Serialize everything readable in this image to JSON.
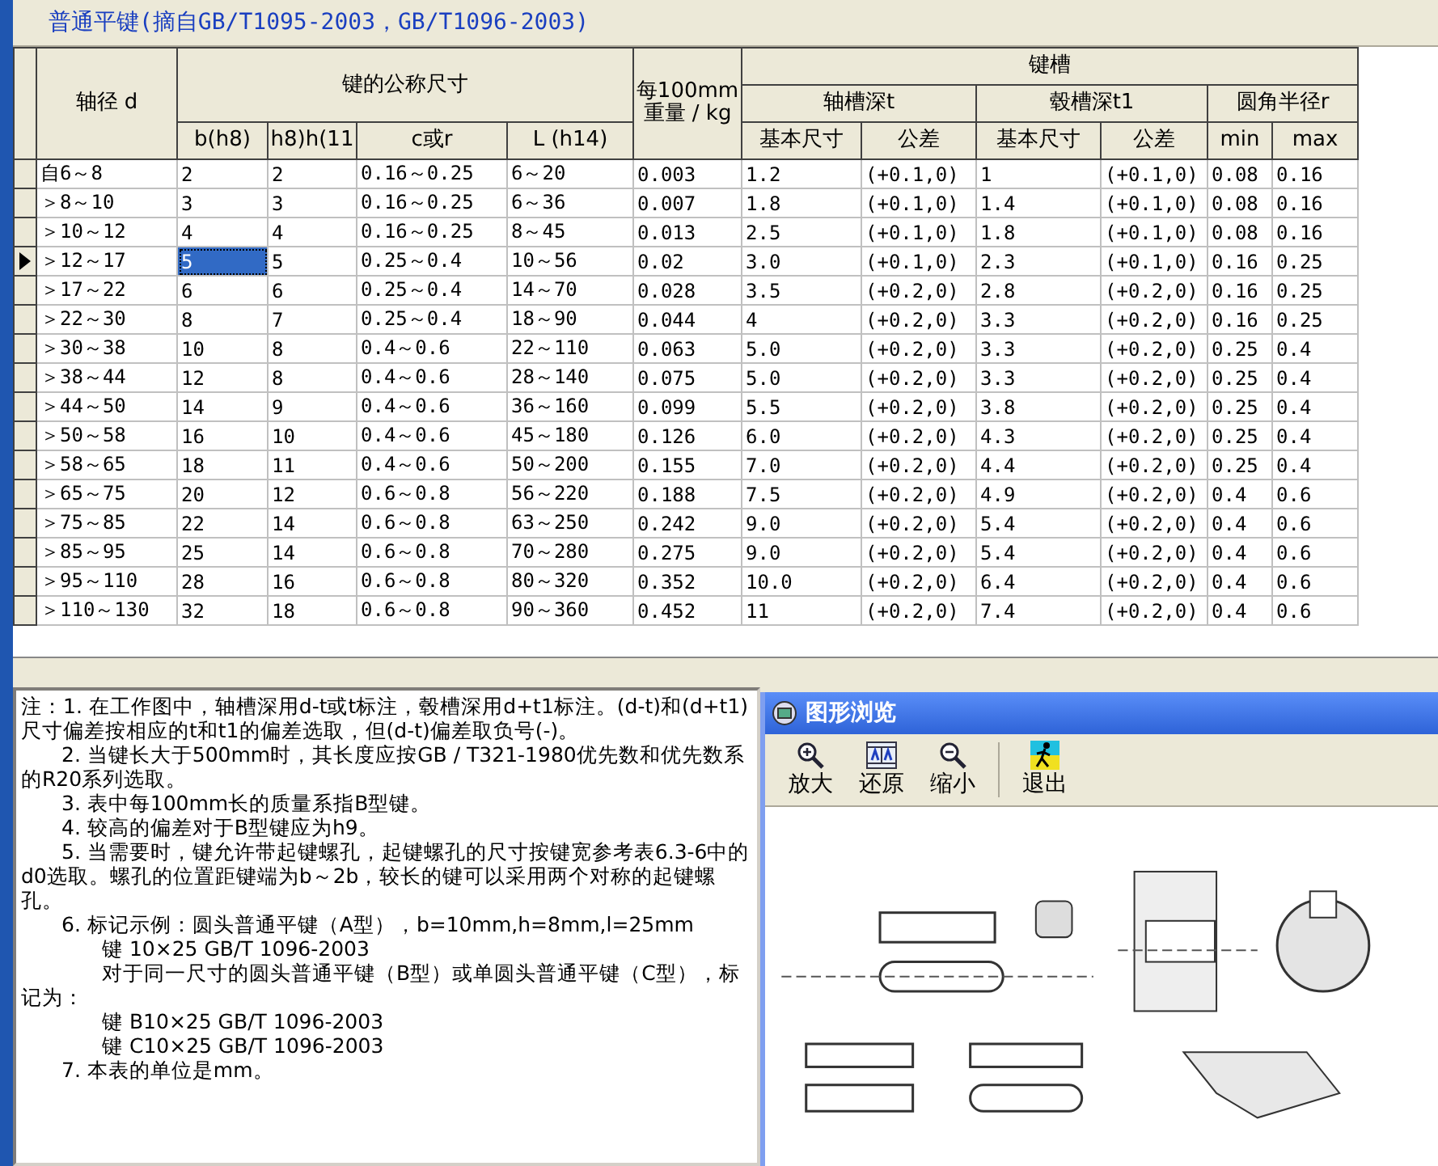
{
  "title": "普通平键(摘自GB/T1095-2003，GB/T1096-2003)",
  "table": {
    "header": [
      {
        "label": "轴径 d"
      },
      {
        "label": "键的公称尺寸",
        "children": [
          {
            "label": "b(h8)"
          },
          {
            "label": "h8)h(11"
          },
          {
            "label": "c或r"
          },
          {
            "label": "L (h14)"
          }
        ]
      },
      {
        "label": "每100mm重量 / kg"
      },
      {
        "label": "键槽",
        "children": [
          {
            "label": "轴槽深t",
            "children": [
              {
                "label": "基本尺寸"
              },
              {
                "label": "公差"
              }
            ]
          },
          {
            "label": "毂槽深t1",
            "children": [
              {
                "label": "基本尺寸"
              },
              {
                "label": "公差"
              }
            ]
          },
          {
            "label": "圆角半径r",
            "children": [
              {
                "label": "min"
              },
              {
                "label": "max"
              }
            ]
          }
        ]
      }
    ],
    "rows": [
      {
        "selected": false,
        "cells": [
          {
            "text": "自6～8",
            "selected": false
          },
          {
            "text": "2",
            "selected": false
          },
          {
            "text": "2",
            "selected": false
          },
          {
            "text": "0.16～0.25",
            "selected": false
          },
          {
            "text": "6～20",
            "selected": false
          },
          {
            "text": "0.003",
            "selected": false
          },
          {
            "text": "1.2",
            "selected": false
          },
          {
            "text": "(+0.1,0)",
            "selected": false
          },
          {
            "text": "1",
            "selected": false
          },
          {
            "text": "(+0.1,0)",
            "selected": false
          },
          {
            "text": "0.08",
            "selected": false
          },
          {
            "text": "0.16",
            "selected": false
          }
        ]
      },
      {
        "selected": false,
        "cells": [
          {
            "text": "＞8～10",
            "selected": false
          },
          {
            "text": "3",
            "selected": false
          },
          {
            "text": "3",
            "selected": false
          },
          {
            "text": "0.16～0.25",
            "selected": false
          },
          {
            "text": "6～36",
            "selected": false
          },
          {
            "text": "0.007",
            "selected": false
          },
          {
            "text": "1.8",
            "selected": false
          },
          {
            "text": "(+0.1,0)",
            "selected": false
          },
          {
            "text": "1.4",
            "selected": false
          },
          {
            "text": "(+0.1,0)",
            "selected": false
          },
          {
            "text": "0.08",
            "selected": false
          },
          {
            "text": "0.16",
            "selected": false
          }
        ]
      },
      {
        "selected": false,
        "cells": [
          {
            "text": "＞10～12",
            "selected": false
          },
          {
            "text": "4",
            "selected": false
          },
          {
            "text": "4",
            "selected": false
          },
          {
            "text": "0.16～0.25",
            "selected": false
          },
          {
            "text": "8～45",
            "selected": false
          },
          {
            "text": "0.013",
            "selected": false
          },
          {
            "text": "2.5",
            "selected": false
          },
          {
            "text": "(+0.1,0)",
            "selected": false
          },
          {
            "text": "1.8",
            "selected": false
          },
          {
            "text": "(+0.1,0)",
            "selected": false
          },
          {
            "text": "0.08",
            "selected": false
          },
          {
            "text": "0.16",
            "selected": false
          }
        ]
      },
      {
        "selected": true,
        "cells": [
          {
            "text": "＞12～17",
            "selected": false
          },
          {
            "text": "5",
            "selected": true
          },
          {
            "text": "5",
            "selected": false
          },
          {
            "text": "0.25～0.4",
            "selected": false
          },
          {
            "text": "10～56",
            "selected": false
          },
          {
            "text": "0.02",
            "selected": false
          },
          {
            "text": "3.0",
            "selected": false
          },
          {
            "text": "(+0.1,0)",
            "selected": false
          },
          {
            "text": "2.3",
            "selected": false
          },
          {
            "text": "(+0.1,0)",
            "selected": false
          },
          {
            "text": "0.16",
            "selected": false
          },
          {
            "text": "0.25",
            "selected": false
          }
        ]
      },
      {
        "selected": false,
        "cells": [
          {
            "text": "＞17～22",
            "selected": false
          },
          {
            "text": "6",
            "selected": false
          },
          {
            "text": "6",
            "selected": false
          },
          {
            "text": "0.25～0.4",
            "selected": false
          },
          {
            "text": "14～70",
            "selected": false
          },
          {
            "text": "0.028",
            "selected": false
          },
          {
            "text": "3.5",
            "selected": false
          },
          {
            "text": "(+0.2,0)",
            "selected": false
          },
          {
            "text": "2.8",
            "selected": false
          },
          {
            "text": "(+0.2,0)",
            "selected": false
          },
          {
            "text": "0.16",
            "selected": false
          },
          {
            "text": "0.25",
            "selected": false
          }
        ]
      },
      {
        "selected": false,
        "cells": [
          {
            "text": "＞22～30",
            "selected": false
          },
          {
            "text": "8",
            "selected": false
          },
          {
            "text": "7",
            "selected": false
          },
          {
            "text": "0.25～0.4",
            "selected": false
          },
          {
            "text": "18～90",
            "selected": false
          },
          {
            "text": "0.044",
            "selected": false
          },
          {
            "text": "4",
            "selected": false
          },
          {
            "text": "(+0.2,0)",
            "selected": false
          },
          {
            "text": "3.3",
            "selected": false
          },
          {
            "text": "(+0.2,0)",
            "selected": false
          },
          {
            "text": "0.16",
            "selected": false
          },
          {
            "text": "0.25",
            "selected": false
          }
        ]
      },
      {
        "selected": false,
        "cells": [
          {
            "text": "＞30～38",
            "selected": false
          },
          {
            "text": "10",
            "selected": false
          },
          {
            "text": "8",
            "selected": false
          },
          {
            "text": "0.4～0.6",
            "selected": false
          },
          {
            "text": "22～110",
            "selected": false
          },
          {
            "text": "0.063",
            "selected": false
          },
          {
            "text": "5.0",
            "selected": false
          },
          {
            "text": "(+0.2,0)",
            "selected": false
          },
          {
            "text": "3.3",
            "selected": false
          },
          {
            "text": "(+0.2,0)",
            "selected": false
          },
          {
            "text": "0.25",
            "selected": false
          },
          {
            "text": "0.4",
            "selected": false
          }
        ]
      },
      {
        "selected": false,
        "cells": [
          {
            "text": "＞38～44",
            "selected": false
          },
          {
            "text": "12",
            "selected": false
          },
          {
            "text": "8",
            "selected": false
          },
          {
            "text": "0.4～0.6",
            "selected": false
          },
          {
            "text": "28～140",
            "selected": false
          },
          {
            "text": "0.075",
            "selected": false
          },
          {
            "text": "5.0",
            "selected": false
          },
          {
            "text": "(+0.2,0)",
            "selected": false
          },
          {
            "text": "3.3",
            "selected": false
          },
          {
            "text": "(+0.2,0)",
            "selected": false
          },
          {
            "text": "0.25",
            "selected": false
          },
          {
            "text": "0.4",
            "selected": false
          }
        ]
      },
      {
        "selected": false,
        "cells": [
          {
            "text": "＞44～50",
            "selected": false
          },
          {
            "text": "14",
            "selected": false
          },
          {
            "text": "9",
            "selected": false
          },
          {
            "text": "0.4～0.6",
            "selected": false
          },
          {
            "text": "36～160",
            "selected": false
          },
          {
            "text": "0.099",
            "selected": false
          },
          {
            "text": "5.5",
            "selected": false
          },
          {
            "text": "(+0.2,0)",
            "selected": false
          },
          {
            "text": "3.8",
            "selected": false
          },
          {
            "text": "(+0.2,0)",
            "selected": false
          },
          {
            "text": "0.25",
            "selected": false
          },
          {
            "text": "0.4",
            "selected": false
          }
        ]
      },
      {
        "selected": false,
        "cells": [
          {
            "text": "＞50～58",
            "selected": false
          },
          {
            "text": "16",
            "selected": false
          },
          {
            "text": "10",
            "selected": false
          },
          {
            "text": "0.4～0.6",
            "selected": false
          },
          {
            "text": "45～180",
            "selected": false
          },
          {
            "text": "0.126",
            "selected": false
          },
          {
            "text": "6.0",
            "selected": false
          },
          {
            "text": "(+0.2,0)",
            "selected": false
          },
          {
            "text": "4.3",
            "selected": false
          },
          {
            "text": "(+0.2,0)",
            "selected": false
          },
          {
            "text": "0.25",
            "selected": false
          },
          {
            "text": "0.4",
            "selected": false
          }
        ]
      },
      {
        "selected": false,
        "cells": [
          {
            "text": "＞58～65",
            "selected": false
          },
          {
            "text": "18",
            "selected": false
          },
          {
            "text": "11",
            "selected": false
          },
          {
            "text": "0.4～0.6",
            "selected": false
          },
          {
            "text": "50～200",
            "selected": false
          },
          {
            "text": "0.155",
            "selected": false
          },
          {
            "text": "7.0",
            "selected": false
          },
          {
            "text": "(+0.2,0)",
            "selected": false
          },
          {
            "text": "4.4",
            "selected": false
          },
          {
            "text": "(+0.2,0)",
            "selected": false
          },
          {
            "text": "0.25",
            "selected": false
          },
          {
            "text": "0.4",
            "selected": false
          }
        ]
      },
      {
        "selected": false,
        "cells": [
          {
            "text": "＞65～75",
            "selected": false
          },
          {
            "text": "20",
            "selected": false
          },
          {
            "text": "12",
            "selected": false
          },
          {
            "text": "0.6～0.8",
            "selected": false
          },
          {
            "text": "56～220",
            "selected": false
          },
          {
            "text": "0.188",
            "selected": false
          },
          {
            "text": "7.5",
            "selected": false
          },
          {
            "text": "(+0.2,0)",
            "selected": false
          },
          {
            "text": "4.9",
            "selected": false
          },
          {
            "text": "(+0.2,0)",
            "selected": false
          },
          {
            "text": "0.4",
            "selected": false
          },
          {
            "text": "0.6",
            "selected": false
          }
        ]
      },
      {
        "selected": false,
        "cells": [
          {
            "text": "＞75～85",
            "selected": false
          },
          {
            "text": "22",
            "selected": false
          },
          {
            "text": "14",
            "selected": false
          },
          {
            "text": "0.6～0.8",
            "selected": false
          },
          {
            "text": "63～250",
            "selected": false
          },
          {
            "text": "0.242",
            "selected": false
          },
          {
            "text": "9.0",
            "selected": false
          },
          {
            "text": "(+0.2,0)",
            "selected": false
          },
          {
            "text": "5.4",
            "selected": false
          },
          {
            "text": "(+0.2,0)",
            "selected": false
          },
          {
            "text": "0.4",
            "selected": false
          },
          {
            "text": "0.6",
            "selected": false
          }
        ]
      },
      {
        "selected": false,
        "cells": [
          {
            "text": "＞85～95",
            "selected": false
          },
          {
            "text": "25",
            "selected": false
          },
          {
            "text": "14",
            "selected": false
          },
          {
            "text": "0.6～0.8",
            "selected": false
          },
          {
            "text": "70～280",
            "selected": false
          },
          {
            "text": "0.275",
            "selected": false
          },
          {
            "text": "9.0",
            "selected": false
          },
          {
            "text": "(+0.2,0)",
            "selected": false
          },
          {
            "text": "5.4",
            "selected": false
          },
          {
            "text": "(+0.2,0)",
            "selected": false
          },
          {
            "text": "0.4",
            "selected": false
          },
          {
            "text": "0.6",
            "selected": false
          }
        ]
      },
      {
        "selected": false,
        "cells": [
          {
            "text": "＞95～110",
            "selected": false
          },
          {
            "text": "28",
            "selected": false
          },
          {
            "text": "16",
            "selected": false
          },
          {
            "text": "0.6～0.8",
            "selected": false
          },
          {
            "text": "80～320",
            "selected": false
          },
          {
            "text": "0.352",
            "selected": false
          },
          {
            "text": "10.0",
            "selected": false
          },
          {
            "text": "(+0.2,0)",
            "selected": false
          },
          {
            "text": "6.4",
            "selected": false
          },
          {
            "text": "(+0.2,0)",
            "selected": false
          },
          {
            "text": "0.4",
            "selected": false
          },
          {
            "text": "0.6",
            "selected": false
          }
        ]
      },
      {
        "selected": false,
        "cells": [
          {
            "text": "＞110～130",
            "selected": false
          },
          {
            "text": "32",
            "selected": false
          },
          {
            "text": "18",
            "selected": false
          },
          {
            "text": "0.6～0.8",
            "selected": false
          },
          {
            "text": "90～360",
            "selected": false
          },
          {
            "text": "0.452",
            "selected": false
          },
          {
            "text": "11",
            "selected": false
          },
          {
            "text": "(+0.2,0)",
            "selected": false
          },
          {
            "text": "7.4",
            "selected": false
          },
          {
            "text": "(+0.2,0)",
            "selected": false
          },
          {
            "text": "0.4",
            "selected": false
          },
          {
            "text": "0.6",
            "selected": false
          }
        ]
      }
    ]
  },
  "notes": [
    {
      "kind": "lead",
      "text": "注：1. 在工作图中，轴槽深用d-t或t标注，毂槽深用d+t1标注。(d-t)和(d+t1)尺寸偏差按相应的t和t1的偏差选取，但(d-t)偏差取负号(-)。"
    },
    {
      "kind": "item",
      "text": "2. 当键长大于500mm时，其长度应按GB / T321-1980优先数和优先数系的R20系列选取。"
    },
    {
      "kind": "item",
      "text": "3. 表中每100mm长的质量系指B型键。"
    },
    {
      "kind": "item",
      "text": "4. 较高的偏差对于B型键应为h9。"
    },
    {
      "kind": "item",
      "text": "5. 当需要时，键允许带起键螺孔，起键螺孔的尺寸按键宽参考表6.3-6中的d0选取。螺孔的位置距键端为b～2b，较长的键可以采用两个对称的起键螺孔。"
    },
    {
      "kind": "item",
      "text": "6. 标记示例：圆头普通平键（A型），b=10mm,h=8mm,l=25mm"
    },
    {
      "kind": "sub",
      "text": "键 10×25  GB/T 1096-2003"
    },
    {
      "kind": "sub",
      "text": "对于同一尺寸的圆头普通平键（B型）或单圆头普通平键（C型），标记为："
    },
    {
      "kind": "sub",
      "text": "键  B10×25 GB/T 1096-2003"
    },
    {
      "kind": "sub",
      "text": "键  C10×25 GB/T 1096-2003"
    },
    {
      "kind": "item",
      "text": "7. 本表的单位是mm。"
    }
  ],
  "viewer": {
    "title": "图形浏览",
    "toolbar": [
      {
        "kind": "zoom_in",
        "label": "放大"
      },
      {
        "kind": "restore",
        "label": "还原"
      },
      {
        "kind": "zoom_out",
        "label": "缩小"
      },
      {
        "kind": "exit",
        "label": "退出"
      }
    ]
  }
}
